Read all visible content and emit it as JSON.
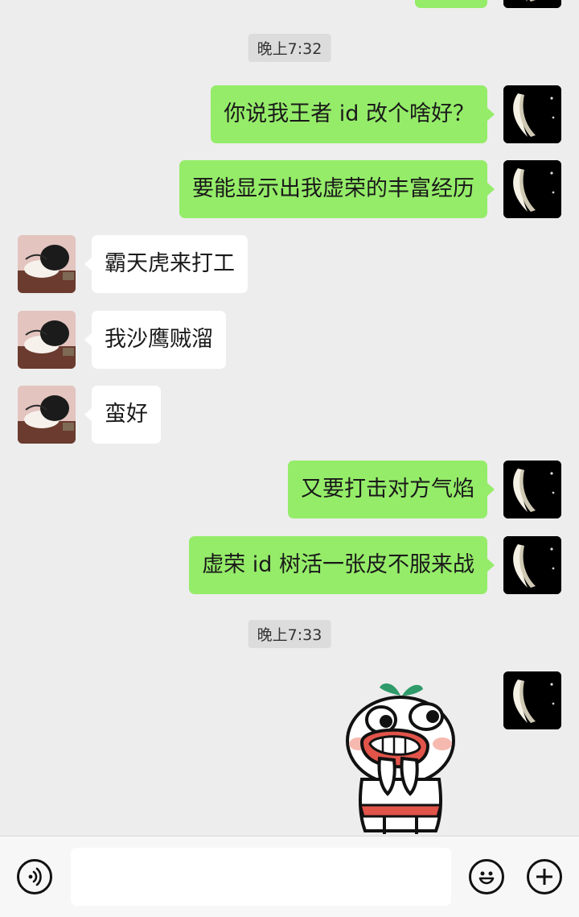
{
  "chat": {
    "partial_top": {
      "sender": "me"
    },
    "sections": [
      {
        "time": "晚上7:32",
        "messages": [
          {
            "sender": "me",
            "text": "你说我王者 id 改个啥好？"
          },
          {
            "sender": "me",
            "text": "要能显示出我虚荣的丰富经历"
          },
          {
            "sender": "peer",
            "text": "霸天虎来打工"
          },
          {
            "sender": "peer",
            "text": "我沙鹰贼溜"
          },
          {
            "sender": "peer",
            "text": "蛮好"
          },
          {
            "sender": "me",
            "text": "又要打击对方气焰"
          },
          {
            "sender": "me",
            "text": "虚荣 id 树活一张皮不服来战"
          }
        ]
      },
      {
        "time": "晚上7:33",
        "messages": [
          {
            "sender": "me",
            "type": "sticker",
            "sticker": "laughing-cartoon-sticker"
          }
        ]
      }
    ]
  },
  "input_bar": {
    "voice_icon": "voice-icon",
    "input_value": "",
    "emoji_icon": "emoji-icon",
    "plus_icon": "plus-icon"
  },
  "colors": {
    "background": "#ededed",
    "my_bubble": "#95ec69",
    "peer_bubble": "#ffffff",
    "timestamp_bg": "#dcdcdc",
    "input_bar": "#f7f7f7"
  }
}
